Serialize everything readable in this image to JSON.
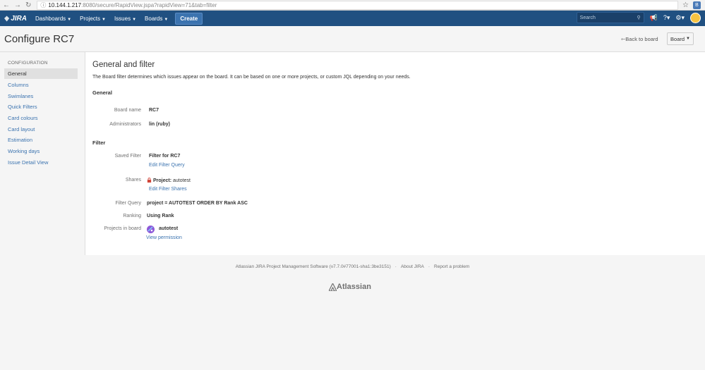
{
  "browser": {
    "url_host": "10.144.1.217",
    "url_path": ":8080/secure/RapidView.jspa?rapidView=71&tab=filter"
  },
  "header": {
    "logo_text": "JIRA",
    "nav": [
      "Dashboards",
      "Projects",
      "Issues",
      "Boards"
    ],
    "create_label": "Create",
    "search_placeholder": "Search",
    "brand_color": "#205081"
  },
  "page": {
    "title": "Configure RC7",
    "back_link": "Back to board",
    "board_button": "Board"
  },
  "sidebar": {
    "heading": "CONFIGURATION",
    "items": [
      {
        "label": "General",
        "active": true
      },
      {
        "label": "Columns"
      },
      {
        "label": "Swimlanes"
      },
      {
        "label": "Quick Filters"
      },
      {
        "label": "Card colours"
      },
      {
        "label": "Card layout"
      },
      {
        "label": "Estimation"
      },
      {
        "label": "Working days"
      },
      {
        "label": "Issue Detail View"
      }
    ]
  },
  "main": {
    "title": "General and filter",
    "description": "The Board filter determines which issues appear on the board. It can be based on one or more projects, or custom JQL depending on your needs.",
    "general": {
      "heading": "General",
      "board_name_label": "Board name",
      "board_name": "RC7",
      "administrators_label": "Administrators",
      "administrators": "lin (ruby)"
    },
    "filter": {
      "heading": "Filter",
      "saved_filter_label": "Saved Filter",
      "saved_filter": "Filter for RC7",
      "edit_filter_query": "Edit Filter Query",
      "shares_label": "Shares",
      "shares_prefix": "Project:",
      "shares_value": "autotest",
      "edit_filter_shares": "Edit Filter Shares",
      "filter_query_label": "Filter Query",
      "filter_query": "project = AUTOTEST ORDER BY Rank ASC",
      "ranking_label": "Ranking",
      "ranking": "Using Rank",
      "projects_label": "Projects in board",
      "project_name": "autotest",
      "view_permission": "View permission"
    }
  },
  "footer": {
    "software": "Atlassian JIRA Project Management Software (v7.7.0#77001-sha1:3be3151)",
    "about": "About JIRA",
    "report": "Report a problem",
    "logo_text": "Atlassian"
  }
}
